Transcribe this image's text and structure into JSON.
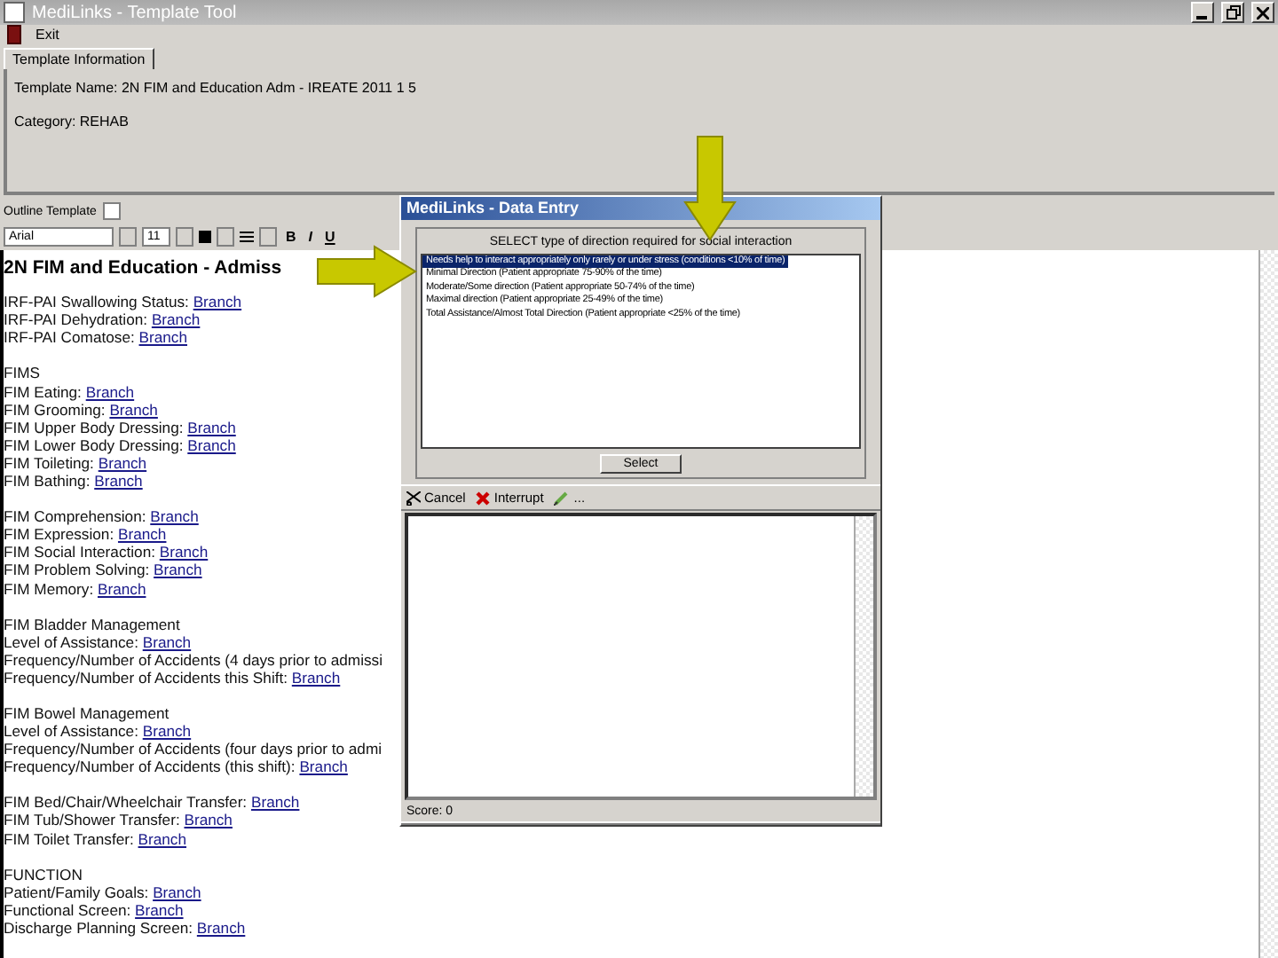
{
  "window": {
    "title": "MediLinks - Template Tool"
  },
  "menu": [
    {
      "label": "Exit"
    }
  ],
  "tabs": [
    {
      "label": "Template Information",
      "selected": true
    }
  ],
  "template_info": {
    "name": "Template Name: 2N FIM and Education Adm - IREATE 2011 1 5",
    "category": "Category: REHAB"
  },
  "outline_template": {
    "label": "Outline Template",
    "checked": false
  },
  "format_toolbar": {
    "font": "Arial",
    "size": "11",
    "bold": "B",
    "italic": "I",
    "underline": "U"
  },
  "editor": {
    "heading": "2N FIM and Education - Admiss",
    "groups": [
      {
        "lines": [
          {
            "label": "IRF-PAI Swallowing Status:",
            "link": "Branch"
          },
          {
            "label": "IRF-PAI Dehydration:",
            "link": "Branch"
          },
          {
            "label": "IRF-PAI Comatose:",
            "link": "Branch"
          }
        ]
      },
      {
        "lines": [
          {
            "label": "FIMS"
          },
          {
            "label": "FIM Eating:",
            "link": "Branch"
          },
          {
            "label": "FIM Grooming:",
            "link": "Branch"
          },
          {
            "label": "FIM Upper Body Dressing:",
            "link": "Branch"
          },
          {
            "label": "FIM Lower Body Dressing:",
            "link": "Branch"
          },
          {
            "label": "FIM Toileting:",
            "link": "Branch"
          },
          {
            "label": "FIM Bathing:",
            "link": "Branch"
          }
        ]
      },
      {
        "lines": [
          {
            "label": "FIM Comprehension:",
            "link": "Branch"
          },
          {
            "label": "FIM Expression:",
            "link": "Branch"
          },
          {
            "label": "FIM Social Interaction:",
            "link": "Branch"
          },
          {
            "label": "FIM Problem Solving:",
            "link": "Branch"
          },
          {
            "label": "FIM Memory:",
            "link": "Branch"
          }
        ]
      },
      {
        "lines": [
          {
            "label": "FIM Bladder Management"
          },
          {
            "label": "Level of Assistance:",
            "link": "Branch"
          },
          {
            "label": "Frequency/Number of Accidents (4 days prior to admissi"
          },
          {
            "label": "Frequency/Number of Accidents this Shift:",
            "link": "Branch"
          }
        ]
      },
      {
        "lines": [
          {
            "label": "FIM Bowel Management"
          },
          {
            "label": "Level of Assistance:",
            "link": "Branch"
          },
          {
            "label": "Frequency/Number of Accidents (four days prior to admi"
          },
          {
            "label": "Frequency/Number of Accidents (this shift):",
            "link": "Branch"
          }
        ]
      },
      {
        "lines": [
          {
            "label": "FIM Bed/Chair/Wheelchair Transfer:",
            "link": "Branch"
          },
          {
            "label": "FIM Tub/Shower Transfer:",
            "link": "Branch"
          },
          {
            "label": "FIM Toilet Transfer:",
            "link": "Branch"
          }
        ]
      },
      {
        "lines": [
          {
            "label": "FUNCTION"
          },
          {
            "label": "Patient/Family Goals:",
            "link": "Branch"
          },
          {
            "label": "Functional Screen:",
            "link": "Branch"
          },
          {
            "label": "Discharge Planning Screen:",
            "link": "Branch"
          }
        ]
      }
    ]
  },
  "dialog": {
    "title": "MediLinks - Data Entry",
    "prompt": "SELECT type of direction required for social interaction",
    "options": [
      {
        "label": "Needs help to interact appropriately only rarely or under stress (conditions <10% of time)",
        "selected": true
      },
      {
        "label": "Minimal Direction (Patient appropriate 75-90% of the time)",
        "selected": false
      },
      {
        "label": "Moderate/Some direction (Patient appropriate 50-74% of the time)",
        "selected": false
      },
      {
        "label": "Maximal direction (Patient appropriate 25-49% of the time)",
        "selected": false
      },
      {
        "label": "Total Assistance/Almost Total Direction (Patient appropriate <25% of the time)",
        "selected": false
      }
    ],
    "select_button": "Select",
    "cancel": "Cancel",
    "interrupt": "Interrupt",
    "sign": "...",
    "status": "Score: 0"
  }
}
